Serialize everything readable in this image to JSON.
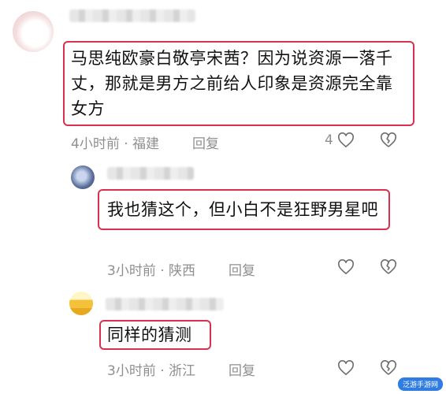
{
  "comments": [
    {
      "text": "马思纯欧豪白敬亭宋茜？因为说资源一落千丈，那就是男方之前给人印象是资源完全靠女方",
      "time_location": "4小时前 · 福建",
      "reply_label": "回复",
      "like_count": "4"
    },
    {
      "text": "我也猜这个，但小白不是狂野男星吧",
      "time_location": "3小时前 · 陕西",
      "reply_label": "回复",
      "like_count": ""
    },
    {
      "text": "同样的猜测",
      "time_location": "3小时前 · 浙江",
      "reply_label": "回复",
      "like_count": ""
    }
  ],
  "watermark": "泛游手游网",
  "colors": {
    "highlight_border": "#d9304f",
    "meta_text": "#8f8f8f"
  }
}
